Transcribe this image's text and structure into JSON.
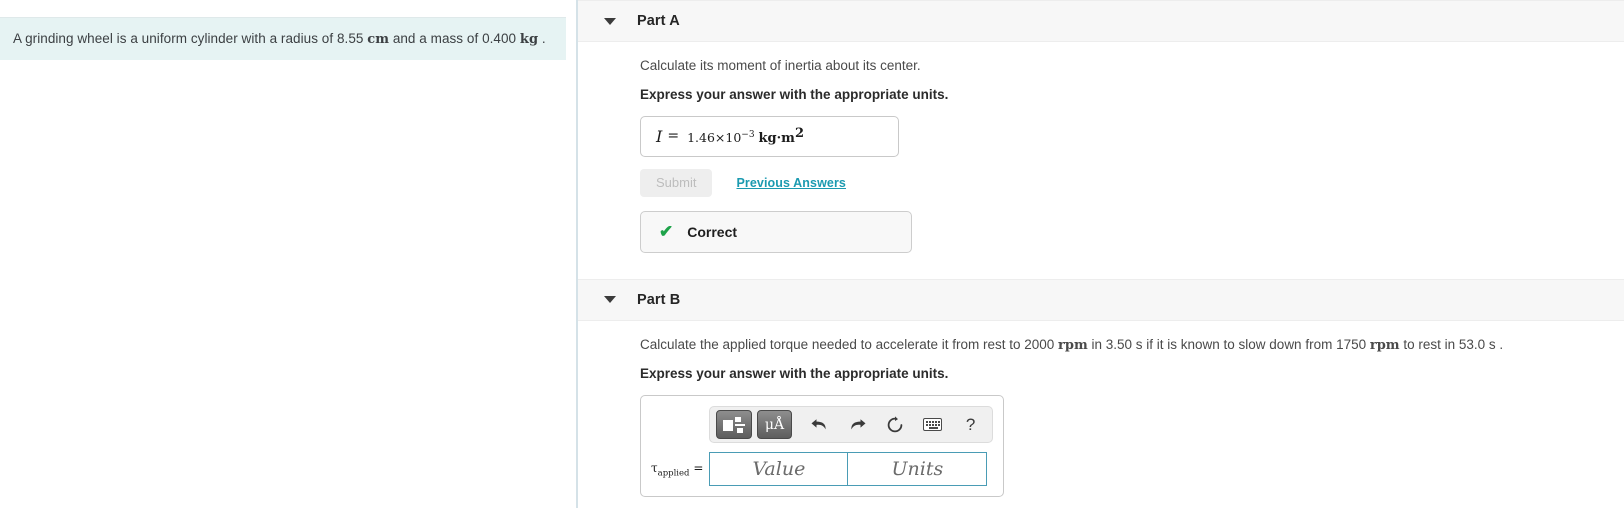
{
  "problem": {
    "text_before_cm": "A grinding wheel is a uniform cylinder with a radius of 8.55 ",
    "unit_cm": "cm",
    "text_between": " and a mass of 0.400 ",
    "unit_kg": "kg",
    "text_after": " ."
  },
  "parts": {
    "a": {
      "title": "Part A",
      "caret": "chevron-down-icon",
      "question": "Calculate its moment of inertia about its center.",
      "instruction": "Express your answer with the appropriate units.",
      "answer": {
        "variable": "I",
        "equals": "=",
        "mantissa": "1.46×10",
        "exponent": "−3",
        "units": "kg·m",
        "units_exponent": "2"
      },
      "submit_label": "Submit",
      "submit_disabled": true,
      "previous_answers_label": "Previous Answers",
      "feedback": {
        "icon": "check-icon",
        "label": "Correct",
        "color": "#1ea34a"
      }
    },
    "b": {
      "title": "Part B",
      "caret": "chevron-down-icon",
      "question_part1": "Calculate the applied torque needed to accelerate it from rest to 2000 ",
      "question_rpm1": "rpm",
      "question_part2": " in 3.50 s if it is known to slow down from 1750 ",
      "question_rpm2": "rpm",
      "question_part3": " to rest in 53.0 s .",
      "instruction": "Express your answer with the appropriate units.",
      "toolbar": {
        "template_button": "math-template-icon",
        "units_button": "μÅ",
        "undo": "undo-icon",
        "redo": "redo-icon",
        "reset": "reset-icon",
        "keyboard": "keyboard-icon",
        "help": "?"
      },
      "input": {
        "label_tau": "τ",
        "label_sub": "applied",
        "equals": "=",
        "value_placeholder": "Value",
        "units_placeholder": "Units"
      }
    }
  },
  "colors": {
    "highlight": "#e6f3f3",
    "link": "#1b9ab0",
    "correct": "#1ea34a",
    "field_border": "#4a9cb5",
    "header_band": "#f7f7f7"
  }
}
